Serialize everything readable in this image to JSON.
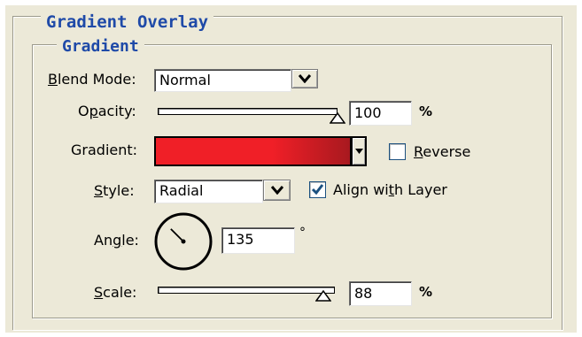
{
  "section_title": "Gradient Overlay",
  "group_title": "Gradient",
  "blend_mode": {
    "label_prefix": "",
    "label_u": "B",
    "label_rest": "lend Mode:",
    "value": "Normal"
  },
  "opacity": {
    "label_pre": "O",
    "label_u": "p",
    "label_rest": "acity:",
    "value": "100",
    "unit": "%",
    "level": 1.0
  },
  "gradient": {
    "label": "Gradient:",
    "start_color": "#f01f27",
    "end_color": "#a8191f"
  },
  "reverse": {
    "label_u": "R",
    "label_rest": "everse",
    "checked": false
  },
  "style": {
    "label_u": "S",
    "label_rest": "tyle:",
    "value": "Radial"
  },
  "align_with_layer": {
    "label_pre": "Align wi",
    "label_u": "t",
    "label_rest": "h Layer",
    "checked": true
  },
  "angle": {
    "label_pre": "An",
    "label_u": "g",
    "label_rest": "le:",
    "value": "135",
    "unit": "°",
    "degrees": 135
  },
  "scale": {
    "label_u": "S",
    "label_rest": "cale:",
    "value": "88",
    "unit": "%",
    "level": 0.88
  },
  "colors": {
    "legend": "#1f4aa8",
    "panel": "#ece9d8",
    "check": "#1c5180"
  }
}
